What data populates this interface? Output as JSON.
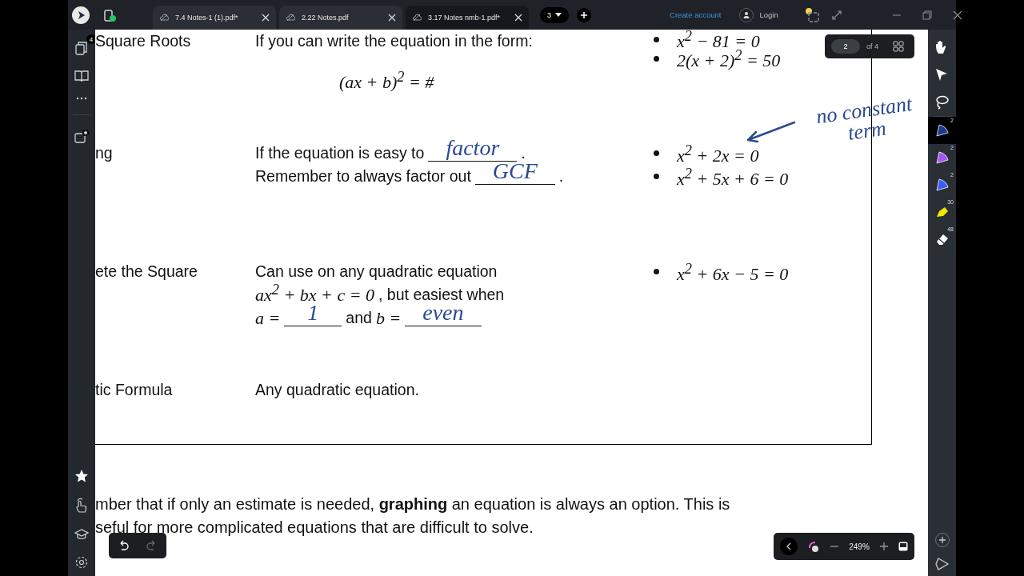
{
  "top_bar": {
    "tabs": [
      {
        "label": "7.4 Notes-1 (1).pdf*",
        "selected": false
      },
      {
        "label": "2.22 Notes.pdf",
        "selected": false
      },
      {
        "label": "3.17 Notes nmb-1.pdf*",
        "selected": true
      }
    ],
    "tab_count": "3",
    "create_account": "Create account",
    "login": "Login"
  },
  "left_sidebar": {
    "pages_badge": "4"
  },
  "document": {
    "rows": [
      {
        "method": "Square Roots",
        "lines": [
          [
            {
              "kind": "text",
              "text": "If you can write the equation in the form:"
            }
          ],
          [
            {
              "kind": "display_math",
              "text": "(ax + b)$^{2}$ = #"
            }
          ]
        ],
        "examples": [
          "x$^{2}$ − 81 = 0",
          "2(x + 2)$^{2}$ = 50"
        ]
      },
      {
        "method": "ng",
        "lines": [
          [
            {
              "kind": "text",
              "text": "If the equation is easy to"
            },
            {
              "kind": "blank",
              "text": "factor"
            },
            {
              "kind": "text",
              "text": "."
            }
          ],
          [
            {
              "kind": "text",
              "text": "Remember to always factor out"
            },
            {
              "kind": "blank",
              "text": "GCF"
            },
            {
              "kind": "text",
              "text": "."
            }
          ]
        ],
        "examples": [
          "x$^{2}$ + 2x = 0",
          "x$^{2}$ + 5x + 6 = 0"
        ]
      },
      {
        "method": "ete the Square",
        "lines": [
          [
            {
              "kind": "text",
              "text": "Can use on any quadratic equation"
            }
          ],
          [
            {
              "kind": "math",
              "text": "ax$^{2}$ + bx + c = 0"
            },
            {
              "kind": "text",
              "text": ", but easiest when"
            }
          ],
          [
            {
              "kind": "math",
              "text": "a ="
            },
            {
              "kind": "blank",
              "text": "1"
            },
            {
              "kind": "text",
              "text": "and"
            },
            {
              "kind": "math",
              "text": "b ="
            },
            {
              "kind": "blank",
              "text": "even"
            }
          ]
        ],
        "examples": [
          "x$^{2}$ + 6x − 5 = 0"
        ]
      },
      {
        "method": "tic Formula",
        "lines": [
          [
            {
              "kind": "text",
              "text": "Any quadratic equation."
            }
          ]
        ],
        "examples": []
      }
    ],
    "note_lines": [
      "mber that if only an estimate is needed, **graphing** an equation is always an option. This is",
      "seful for more complicated equations that are difficult to solve."
    ]
  },
  "margin_note": "no constant term",
  "page_indicator": {
    "current": "2",
    "total": "of 4"
  },
  "tool_rail": {
    "tools": [
      {
        "kind": "hand",
        "selected": false
      },
      {
        "kind": "select",
        "selected": false
      },
      {
        "kind": "lasso",
        "selected": false
      },
      {
        "kind": "pen",
        "color": "#1e3a8a",
        "count": "2",
        "selected": true
      },
      {
        "kind": "pen",
        "color": "#a855f7",
        "count": "2",
        "selected": false
      },
      {
        "kind": "pen",
        "color": "#3b5bf5",
        "count": "2",
        "selected": false
      },
      {
        "kind": "highlighter",
        "color": "#f2e600",
        "count": "30",
        "selected": false
      },
      {
        "kind": "eraser",
        "count": "48",
        "selected": false
      }
    ]
  },
  "zoom_bar": {
    "zoom": "249%"
  }
}
